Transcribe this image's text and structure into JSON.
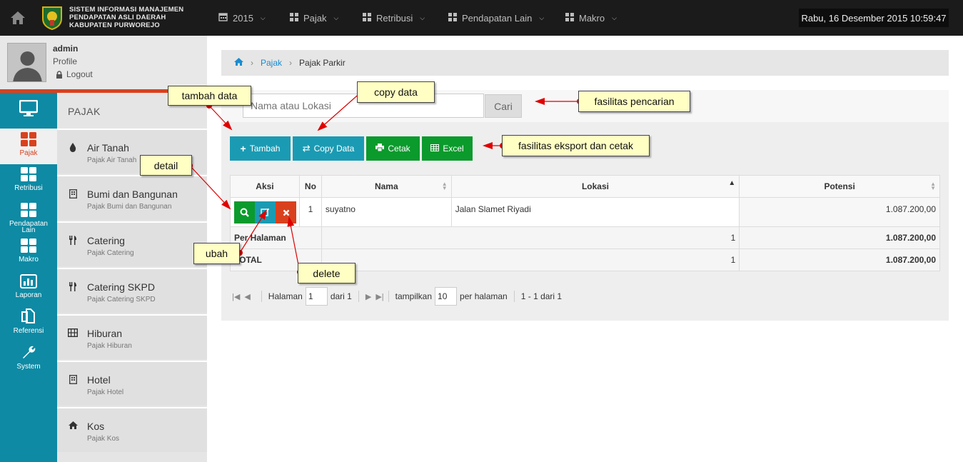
{
  "app": {
    "title_lines": [
      "SISTEM INFORMASI MANAJEMEN",
      "PENDAPATAN ASLI DAERAH",
      "KABUPATEN PURWOREJO"
    ],
    "datetime": "Rabu, 16 Desember 2015  10:59:47"
  },
  "topmenu": [
    {
      "label": "2015",
      "icon": "calendar-icon"
    },
    {
      "label": "Pajak",
      "icon": "grid-icon"
    },
    {
      "label": "Retribusi",
      "icon": "grid-icon"
    },
    {
      "label": "Pendapatan Lain",
      "icon": "grid-icon"
    },
    {
      "label": "Makro",
      "icon": "grid-icon"
    }
  ],
  "user": {
    "name": "admin",
    "profile": "Profile",
    "logout": "Logout"
  },
  "iconnav": [
    {
      "label": "",
      "icon": "monitor-icon"
    },
    {
      "label": "Pajak",
      "icon": "grid-icon",
      "active": true
    },
    {
      "label": "Retribusi",
      "icon": "grid-icon"
    },
    {
      "label": "Pendapatan\nLain",
      "icon": "grid-icon"
    },
    {
      "label": "Makro",
      "icon": "grid-icon"
    },
    {
      "label": "Laporan",
      "icon": "bar-chart-icon"
    },
    {
      "label": "Referensi",
      "icon": "copy-icon"
    },
    {
      "label": "System",
      "icon": "wrench-icon"
    }
  ],
  "submenu": {
    "title": "PAJAK",
    "items": [
      {
        "name": "Air Tanah",
        "desc": "Pajak Air Tanah",
        "icon": "drop-icon"
      },
      {
        "name": "Bumi dan Bangunan",
        "desc": "Pajak Bumi dan Bangunan",
        "icon": "building-icon"
      },
      {
        "name": "Catering",
        "desc": "Pajak Catering",
        "icon": "cutlery-icon"
      },
      {
        "name": "Catering SKPD",
        "desc": "Pajak Catering SKPD",
        "icon": "cutlery-icon"
      },
      {
        "name": "Hiburan",
        "desc": "Pajak Hiburan",
        "icon": "film-icon"
      },
      {
        "name": "Hotel",
        "desc": "Pajak Hotel",
        "icon": "building-icon"
      },
      {
        "name": "Kos",
        "desc": "Pajak Kos",
        "icon": "home-icon"
      }
    ]
  },
  "breadcrumb": {
    "link": "Pajak",
    "current": "Pajak Parkir"
  },
  "search": {
    "placeholder": "Nama atau Lokasi",
    "button": "Cari"
  },
  "toolbar": {
    "tambah": "Tambah",
    "copy": "Copy Data",
    "cetak": "Cetak",
    "excel": "Excel"
  },
  "table": {
    "headers": {
      "aksi": "Aksi",
      "no": "No",
      "nama": "Nama",
      "lokasi": "Lokasi",
      "potensi": "Potensi"
    },
    "rows": [
      {
        "no": "1",
        "nama": "suyatno",
        "lokasi": "Jalan Slamet Riyadi",
        "potensi": "1.087.200,00"
      }
    ],
    "per_halaman": {
      "label": "Per Halaman",
      "count": "1",
      "total": "1.087.200,00"
    },
    "total": {
      "label": "TOTAL",
      "count": "1",
      "total": "1.087.200,00"
    }
  },
  "pager": {
    "halaman": "Halaman",
    "page": "1",
    "dari": "dari 1",
    "tampilkan": "tampilkan",
    "per_page": "10",
    "per_halaman": "per halaman",
    "info": "1 - 1 dari 1"
  },
  "notes": {
    "tambah": "tambah data",
    "copy": "copy data",
    "pencarian": "fasilitas pencarian",
    "eksport": "fasilitas eksport dan cetak",
    "detail": "detail",
    "ubah": "ubah",
    "delete": "delete"
  },
  "colors": {
    "topbar": "#1b1b1b",
    "nav": "#0e8aa4",
    "accent": "#d9411e",
    "teal_btn": "#1a9bb3",
    "green_btn": "#0b9a2c",
    "note_bg": "#ffffc4",
    "arrow": "#e00000"
  }
}
